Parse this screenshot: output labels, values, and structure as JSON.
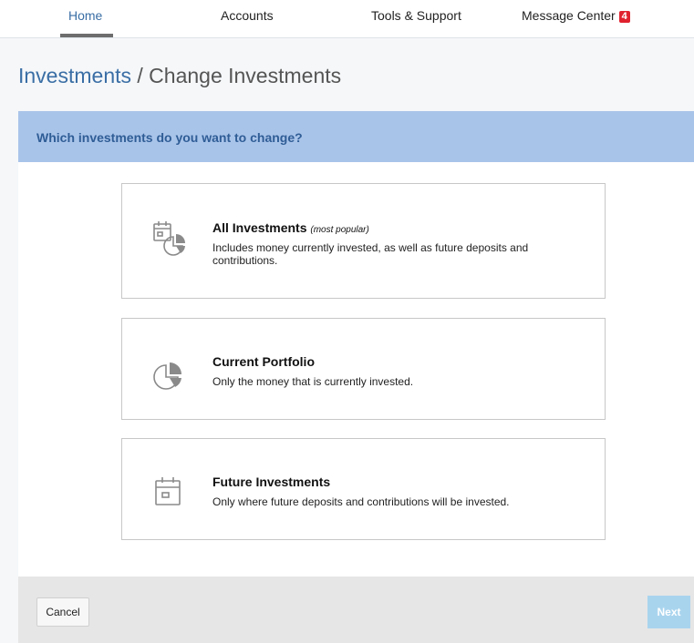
{
  "nav": {
    "items": [
      {
        "label": "Home",
        "active": true
      },
      {
        "label": "Accounts"
      },
      {
        "label": "Tools & Support"
      },
      {
        "label": "Message Center",
        "badge": "4"
      }
    ]
  },
  "page": {
    "breadcrumb_link": "Investments",
    "separator": " / ",
    "title": "Change Investments"
  },
  "question": "Which investments do you want to change?",
  "options": [
    {
      "title": "All Investments",
      "note": "(most popular)",
      "description": "Includes money currently invested, as well as future deposits and contributions.",
      "icon": "calendar-pie-icon"
    },
    {
      "title": "Current Portfolio",
      "description": "Only the money that is currently invested.",
      "icon": "pie-chart-icon"
    },
    {
      "title": "Future Investments",
      "description": "Only where future deposits and contributions will be invested.",
      "icon": "calendar-icon"
    }
  ],
  "footer": {
    "cancel_label": "Cancel",
    "next_label": "Next"
  },
  "colors": {
    "link_blue": "#3a6ea5",
    "question_bar": "#a9c4e9",
    "badge_red": "#e0212e",
    "next_disabled": "#a9d4ee"
  }
}
